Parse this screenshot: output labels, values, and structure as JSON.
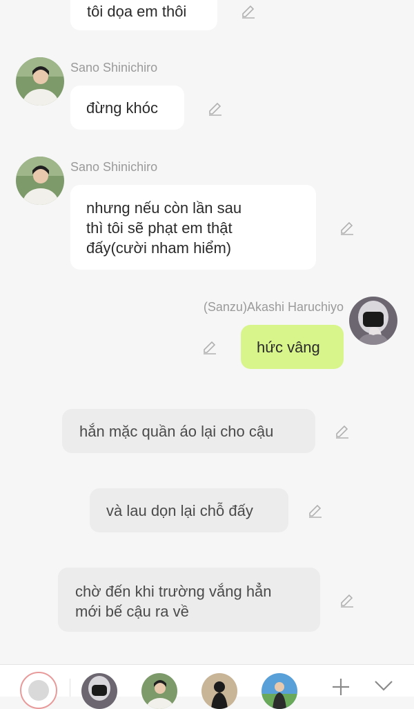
{
  "messages": [
    {
      "kind": "char",
      "text": "tôi dọa em thôi"
    },
    {
      "kind": "char",
      "name": "Sano Shinichiro",
      "text": "đừng khóc"
    },
    {
      "kind": "char",
      "name": "Sano Shinichiro",
      "line1": "nhưng nếu còn lần sau",
      "line2": "thì tôi sẽ phạt em thật",
      "line3": "đấy(cười nham hiểm)"
    },
    {
      "kind": "me",
      "name": "(Sanzu)Akashi Haruchiyo",
      "text": "hức vâng"
    },
    {
      "kind": "narration",
      "text": "hắn mặc quần áo lại cho cậu"
    },
    {
      "kind": "narration",
      "text": "và lau dọn lại chỗ đấy"
    },
    {
      "kind": "narration",
      "line1": "chờ đến khi trường vắng hẳn",
      "line2": "mới bế cậu ra về"
    }
  ],
  "colors": {
    "me_bubble": "#d8f58c",
    "narration_bubble": "#ececec",
    "background": "#f6f6f6"
  },
  "icons": {
    "edit": "pencil-edit-icon",
    "add": "plus-icon",
    "collapse": "chevron-down-icon",
    "chat": "chat-bubble-icon"
  }
}
